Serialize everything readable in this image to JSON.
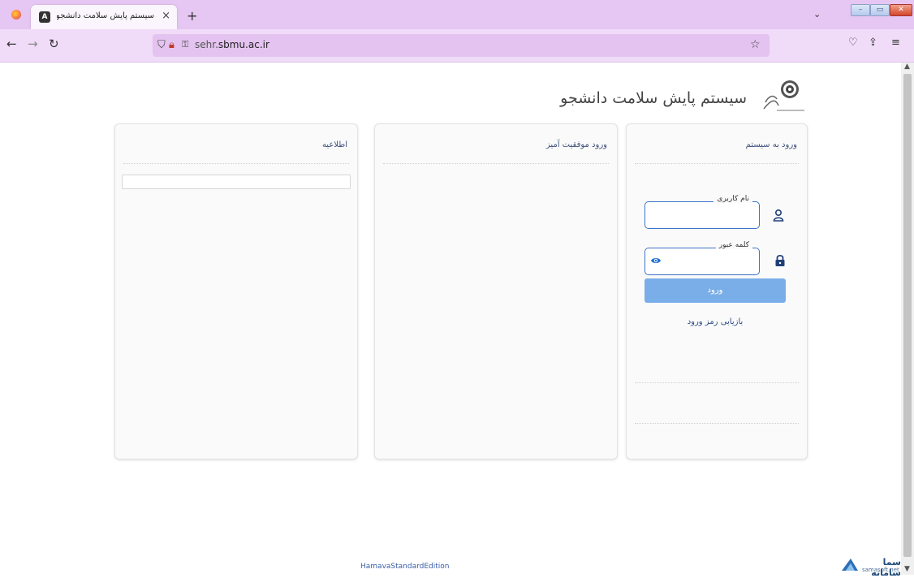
{
  "browser": {
    "tab_title": "سیستم پایش سلامت دانشجو",
    "tab_close": "×",
    "new_tab": "+",
    "tab_list": "⌄",
    "url_host_prefix": "sehr.",
    "url_host_domain": "sbmu.ac.ir",
    "icons": [
      "firefox-icon",
      "angular-tab-icon",
      "back-arrow-icon",
      "forward-arrow-icon",
      "reload-icon",
      "shield-icon",
      "lock-slash-icon",
      "key-icon",
      "star-icon",
      "pocket-icon",
      "extensions-icon",
      "menu-icon"
    ]
  },
  "header": {
    "title": "سیستم پایش سلامت دانشجو"
  },
  "login_card": {
    "heading": "ورود به سیستم",
    "username_label": "نام کاربری",
    "username_value": "",
    "password_label": "کلمه عبور",
    "password_value": "",
    "login_button": "ورود",
    "recover_link": "بازیابی رمز ورود"
  },
  "success_card": {
    "heading": "ورود موفقیت آمیز"
  },
  "notice_card": {
    "heading": "اطلاعیه"
  },
  "footer": {
    "edition": "HamavaStandardEdition",
    "brand_name": "سما سامانه",
    "brand_sub": "samasoft.net"
  },
  "colors": {
    "accent": "#3d73c8",
    "button": "#7aaee8",
    "tabbar": "#e6c6f2"
  }
}
